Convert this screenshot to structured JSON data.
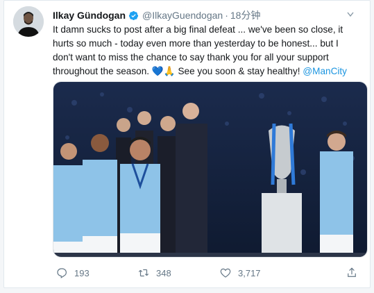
{
  "tweet": {
    "author_name": "Ilkay Gündogan",
    "handle": "@IlkayGuendogan",
    "separator": "·",
    "time": "18分钟",
    "text_main": "It damn sucks to post after a big final defeat ... we've been so close, it hurts so much - today even more than yesterday to be honest... but I don't want to miss the chance to say thank you for all your support throughout the season. 💙🙏 See you soon & stay healthy!",
    "mention": "@ManCity"
  },
  "stats": {
    "replies": "193",
    "retweets": "348",
    "likes": "3,717"
  },
  "icons": {
    "verified": "verified-badge-icon",
    "more": "more-options-icon",
    "reply": "reply-icon",
    "retweet": "retweet-icon",
    "like": "heart-icon",
    "share": "share-icon"
  },
  "colors": {
    "accent": "#1b95e0",
    "text": "#14171a",
    "muted": "#657786",
    "city_blue": "#8ec3e8",
    "night_sky": "#1b2b4d"
  }
}
